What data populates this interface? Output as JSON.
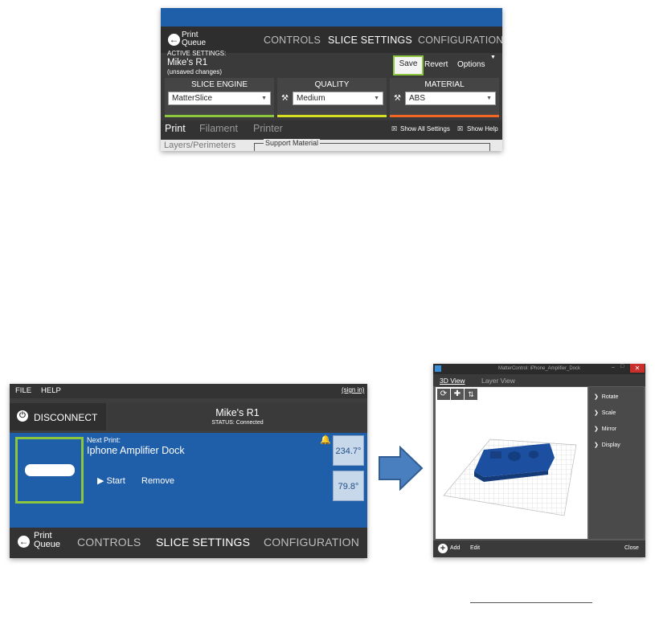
{
  "panel1": {
    "print_queue_label_line1": "Print",
    "print_queue_label_line2": "Queue",
    "nav_tabs": [
      "CONTROLS",
      "SLICE SETTINGS",
      "CONFIGURATION"
    ],
    "active_settings_label": "ACTIVE SETTINGS:",
    "profile_name": "Mike's R1",
    "unsaved_note": "(unsaved changes)",
    "save_label": "Save",
    "revert_label": "Revert",
    "options_label": "Options",
    "slice_engine": {
      "title": "SLICE ENGINE",
      "value": "MatterSlice",
      "accent": "#8cc63f"
    },
    "quality": {
      "title": "QUALITY",
      "value": "Medium",
      "accent": "#d7df21"
    },
    "material": {
      "title": "MATERIAL",
      "value": "ABS",
      "accent": "#f26522"
    },
    "sub_tabs": [
      "Print",
      "Filament",
      "Printer"
    ],
    "show_all_settings": "Show All Settings",
    "show_help": "Show Help",
    "section_left": "Layers/Perimeters",
    "section_right": "Support Material"
  },
  "panel2": {
    "menu_file": "FILE",
    "menu_help": "HELP",
    "sign_in": "(sign in)",
    "disconnect_label": "DISCONNECT",
    "printer_name": "Mike's R1",
    "status_text": "STATUS: Connected",
    "next_print_label": "Next Print:",
    "next_print_name": "Iphone Amplifier Dock",
    "start_label": "Start",
    "remove_label": "Remove",
    "temp_extruder": "234.7°",
    "temp_bed": "79.8°",
    "print_queue_label_line1": "Print",
    "print_queue_label_line2": "Queue",
    "nav_tabs": [
      "CONTROLS",
      "SLICE SETTINGS",
      "CONFIGURATION"
    ]
  },
  "panel3": {
    "window_title": "MatterControl: iPhone_Amplifier_Dock",
    "tabs": [
      "3D View",
      "Layer View"
    ],
    "side_menu": [
      "Rotate",
      "Scale",
      "Mirror",
      "Display"
    ],
    "add_label": "Add",
    "edit_label": "Edit",
    "close_label": "Close",
    "model_color": "#1d4fa0"
  },
  "colors": {
    "highlight": "#8cc63f",
    "brand_blue": "#1f5ea8",
    "arrow_blue": "#4a7fbf"
  }
}
